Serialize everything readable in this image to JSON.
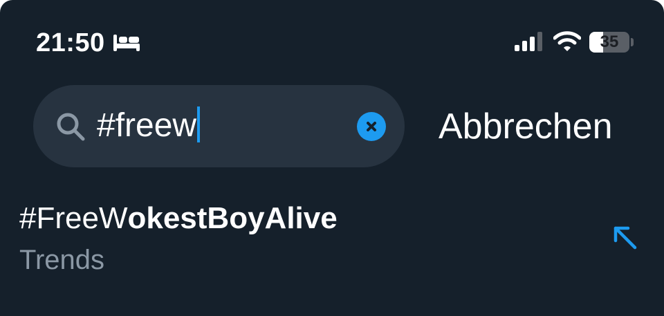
{
  "status_bar": {
    "time": "21:50",
    "focus_icon": "bed-icon",
    "signal_icon": "cellular-signal-icon",
    "wifi_icon": "wifi-icon",
    "battery_level": "35",
    "battery_fraction": 0.35
  },
  "search": {
    "icon": "search-icon",
    "value": "#freew",
    "clear_icon": "clear-icon"
  },
  "cancel_label": "Abbrechen",
  "suggestion": {
    "title_prefix": "#FreeW",
    "title_rest": "okestBoyAlive",
    "subtitle": "Trends",
    "arrow_icon": "arrow-up-left-icon"
  },
  "colors": {
    "background": "#15202b",
    "search_field": "#273340",
    "accent": "#1d9bf0",
    "secondary_text": "#8b98a5"
  }
}
